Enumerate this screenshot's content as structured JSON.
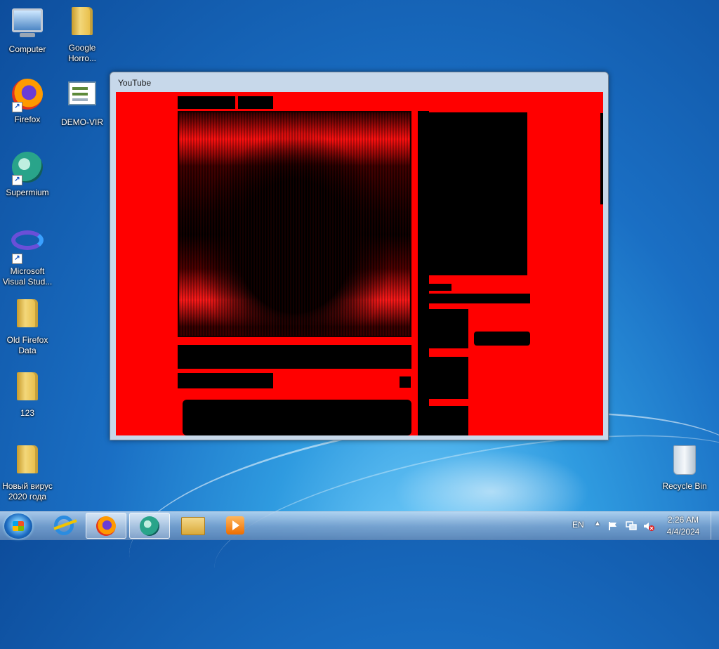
{
  "desktop": {
    "icons": [
      {
        "label": "Computer",
        "icon": "computer-icon"
      },
      {
        "label": "Google Horro...",
        "icon": "folder-icon"
      },
      {
        "label": "Firefox",
        "icon": "firefox-icon"
      },
      {
        "label": "DEMO-VIR",
        "icon": "document-icon"
      },
      {
        "label": "Supermium",
        "icon": "supermium-icon"
      },
      {
        "label": "Microsoft Visual Stud...",
        "icon": "visual-studio-icon"
      },
      {
        "label": "Old Firefox Data",
        "icon": "folder-icon"
      },
      {
        "label": "123",
        "icon": "folder-icon"
      },
      {
        "label": "Новый вирус 2020 года",
        "icon": "folder-icon"
      },
      {
        "label": "Recycle Bin",
        "icon": "recycle-bin-icon"
      }
    ]
  },
  "window": {
    "title": "YouTube",
    "content_tint": "#ff0000"
  },
  "taskbar": {
    "start_icon": "windows-start-icon",
    "pinned": [
      {
        "name": "internet-explorer",
        "icon": "ie-icon"
      },
      {
        "name": "firefox",
        "icon": "firefox-icon"
      },
      {
        "name": "supermium",
        "icon": "supermium-icon"
      },
      {
        "name": "explorer",
        "icon": "folder-icon"
      },
      {
        "name": "media-player",
        "icon": "media-player-icon"
      }
    ],
    "language": "EN",
    "time": "2:26 AM",
    "date": "4/4/2024"
  },
  "colors": {
    "desktop_blue": "#1a6fc4",
    "window_frame": "#c7d8ea",
    "video_red": "#ff0000"
  }
}
